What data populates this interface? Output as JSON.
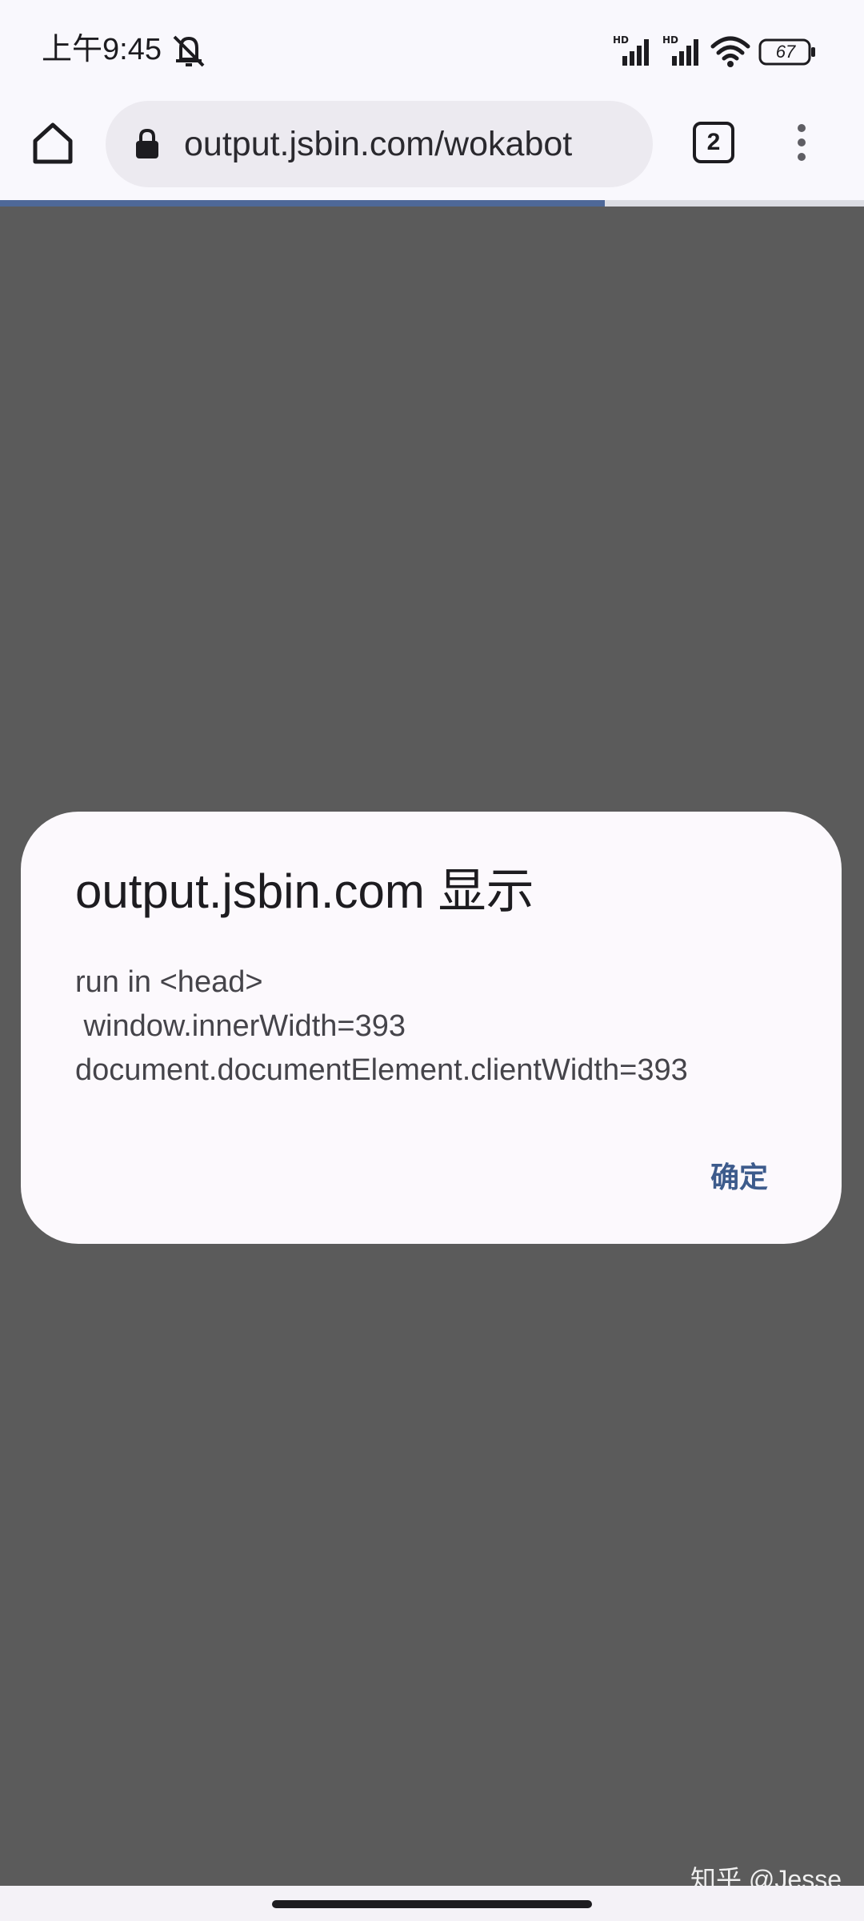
{
  "status_bar": {
    "time": "上午9:45",
    "battery_level": "67",
    "icons": [
      "notifications-muted-icon",
      "hd-signal-icon",
      "hd-signal-icon",
      "wifi-icon",
      "battery-icon"
    ]
  },
  "toolbar": {
    "url": "output.jsbin.com/wokabot",
    "tab_count": "2",
    "load_progress": 0.7,
    "icons": [
      "home-icon",
      "lock-icon",
      "more-vert-icon"
    ]
  },
  "dialog": {
    "title": "output.jsbin.com 显示",
    "message": "run in <head>\n window.innerWidth=393\ndocument.documentElement.clientWidth=393",
    "ok_label": "确定"
  },
  "watermark": "知乎 @Jesse",
  "colors": {
    "scrim": "#5b5b5b",
    "accent": "#3d5b8c",
    "progress": "#4e6898",
    "surface": "#fcf9fd"
  }
}
